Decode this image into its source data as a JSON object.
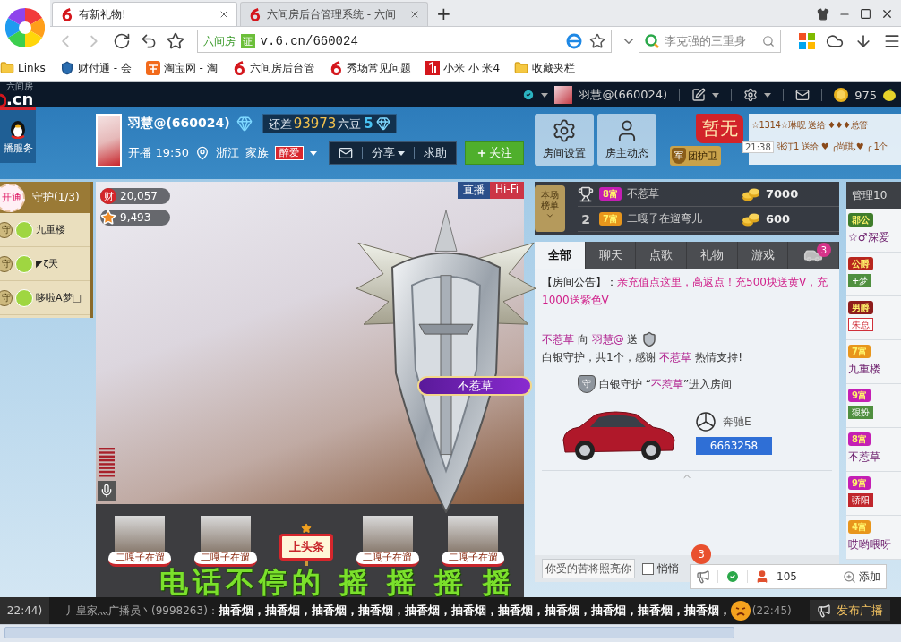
{
  "browser": {
    "tabs": [
      {
        "title": "有新礼物!",
        "selected": true
      },
      {
        "title": "六间房后台管理系统 - 六间",
        "selected": false
      }
    ],
    "new_tab": "+",
    "nav": {
      "back": {
        "disabled": true
      },
      "forward": {
        "disabled": true
      }
    },
    "address": {
      "site_label": "六间房",
      "cert_badge": "证",
      "url": "v.6.cn/660024"
    },
    "search": {
      "value": "李克强的三重身"
    },
    "bookmarks": [
      {
        "kind": "folder",
        "label": "Links"
      },
      {
        "kind": "shield",
        "label": "财付通 - 会"
      },
      {
        "kind": "taobao",
        "label": "淘宝网 - 淘"
      },
      {
        "kind": "six",
        "label": "六间房后台管"
      },
      {
        "kind": "six",
        "label": "秀场常见问题"
      },
      {
        "kind": "mi",
        "label": "小米 小 米4"
      },
      {
        "kind": "folder",
        "label": "收藏夹栏"
      }
    ]
  },
  "site_bar": {
    "logo": ".cn",
    "tagline": "六间房",
    "user": "羽慧@(660024)",
    "coins": "975"
  },
  "header": {
    "service_label": "播服务",
    "streamer": "羽慧@(660024)",
    "progress": {
      "prefix": "还差",
      "amount": "93973",
      "unit": "六豆",
      "level": "5"
    },
    "start": "开播 19:50",
    "location": "浙江",
    "family_label": "家族",
    "family_badge": "醉爱",
    "toolbar": [
      {
        "kind": "mail"
      },
      {
        "kind": "share",
        "label": "分享"
      },
      {
        "kind": "help",
        "label": "求助"
      }
    ],
    "follow": "关注"
  },
  "room_actions": [
    {
      "kind": "settings",
      "label": "房间设置"
    },
    {
      "kind": "owner",
      "label": "房主动态"
    }
  ],
  "headline": {
    "flag": "暂无",
    "guard_emblem": "军",
    "guard_label": "团护卫",
    "marquee": [
      {
        "text": "☆1314☆琳呪 送给 ♦♦♦总管"
      },
      {
        "time": "21:38",
        "text": "张汀1 送给 ♥ ╭尚琪.♥ ╭ 1个"
      }
    ]
  },
  "guardians": {
    "open_label": "开通",
    "title": "守护(1/3)",
    "members": [
      {
        "badge": "守",
        "name": "九重楼"
      },
      {
        "badge": "守",
        "name": "◤ζ天"
      },
      {
        "badge": "守",
        "name": "哆啦A梦□"
      }
    ]
  },
  "video": {
    "stats": [
      {
        "kind": "wealth",
        "badge": "财",
        "value": "20,057"
      },
      {
        "kind": "popularity",
        "value": "9,493"
      }
    ],
    "live_label": "直播",
    "quality": "Hi-Fi",
    "nameplate": "不惹草"
  },
  "headline_strip": {
    "users": [
      {
        "name": "二嘎子在遛"
      },
      {
        "name": "二嘎子在遛"
      },
      {
        "name": "二嘎子在遛"
      },
      {
        "name": "二嘎子在遛"
      }
    ],
    "sign": "上头条",
    "scroll_text": "电话不停的 摇 摇 摇 摇"
  },
  "ranking": {
    "tag": "本场榜单",
    "rows": [
      {
        "kind": "trophy",
        "badge": "8富",
        "color": "#c41fb4",
        "name": "不惹草",
        "amount": "7000"
      },
      {
        "kind": "rank",
        "rank": "2",
        "badge": "7富",
        "color": "#e8961c",
        "name": "二嘎子在遛弯儿",
        "amount": "600"
      }
    ]
  },
  "chat_tabs": [
    {
      "kind": "text",
      "label": "全部",
      "selected": true
    },
    {
      "kind": "text",
      "label": "聊天",
      "selected": false
    },
    {
      "kind": "text",
      "label": "点歌",
      "selected": false
    },
    {
      "kind": "text",
      "label": "礼物",
      "selected": false
    },
    {
      "kind": "text",
      "label": "游戏",
      "selected": false
    },
    {
      "kind": "car",
      "count": "3",
      "selected": false
    }
  ],
  "chat": [
    {
      "kind": "notice",
      "label": "【房间公告】：",
      "text": "亲充值点这里，高返点！充500块送黄V，充1000送紫色V"
    },
    {
      "kind": "gift",
      "head": [
        {
          "kind": "user",
          "text": "不惹草"
        },
        {
          "kind": "text",
          "text": " 向 "
        },
        {
          "kind": "user",
          "text": "羽慧@"
        },
        {
          "kind": "text",
          "text": " 送"
        }
      ],
      "body": [
        {
          "kind": "text",
          "text": "白银守护，共1个，感谢 "
        },
        {
          "kind": "user",
          "text": "不惹草"
        },
        {
          "kind": "text",
          "text": " 热情支持!"
        }
      ]
    },
    {
      "kind": "enter",
      "badge": "守",
      "segments": [
        {
          "kind": "text",
          "text": "白银守护 “"
        },
        {
          "kind": "user",
          "text": "不惹草"
        },
        {
          "kind": "text",
          "text": "”进入房间"
        }
      ]
    },
    {
      "kind": "car",
      "model": "奔驰E",
      "plate": "6663258"
    }
  ],
  "chat_input": {
    "placeholder": "你受的苦将照亮你",
    "whisper": {
      "label": "悄悄",
      "checked": false
    }
  },
  "notify": {
    "count": "3",
    "online": "105",
    "add": "添加"
  },
  "admins": {
    "title": "管理10",
    "members": [
      {
        "badge": "郡公",
        "color": "#3f7d2c",
        "name": "☆♂深爱"
      },
      {
        "badge": "公爵",
        "color": "#b8261e",
        "tag": {
          "kind": "filled",
          "text": "+梦",
          "color": "#4f8f3f"
        }
      },
      {
        "badge": "男爵",
        "color": "#8e1c1c",
        "tag": {
          "kind": "outline",
          "text": "朱总",
          "color": "#d0303a"
        }
      },
      {
        "badge": "7富",
        "color": "#e8961c",
        "name": "九重楼"
      },
      {
        "badge": "9富",
        "color": "#c41fb4",
        "tag": {
          "kind": "filled",
          "text": "狠扮",
          "color": "#4f8f3f"
        }
      },
      {
        "badge": "8富",
        "color": "#c41fb4",
        "name": "不惹草"
      },
      {
        "badge": "9富",
        "color": "#c41fb4",
        "tag": {
          "kind": "filled",
          "text": "骄阳",
          "color": "#c0262c"
        }
      },
      {
        "badge": "4富",
        "color": "#e8961c",
        "name": "哎哟喂呀"
      }
    ]
  },
  "broadcast": {
    "prev_time": "22:44)",
    "sender": "丿皇家灬广播员丶(9998263)：",
    "message": "抽香烟，抽香烟，抽香烟，抽香烟，抽香烟，抽香烟，抽香烟，抽香烟，抽香烟，抽香烟，抽香烟，",
    "time": "(22:45)",
    "button": "发布广播"
  }
}
